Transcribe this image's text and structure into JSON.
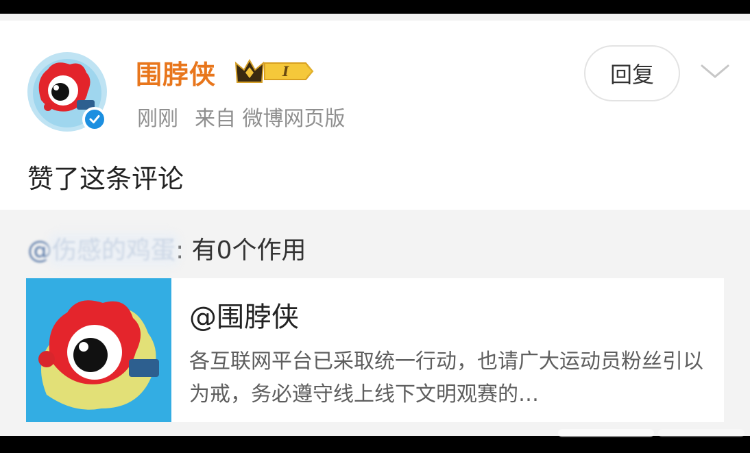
{
  "post": {
    "username": "围脖侠",
    "vip_level": "I",
    "time": "刚刚",
    "source": "来自 微博网页版",
    "reply_label": "回复",
    "comment": "赞了这条评论"
  },
  "quoted_comment": {
    "mention": "@伤感的鸡蛋",
    "text": ": 有0个作用"
  },
  "shared_card": {
    "title": "@围脖侠",
    "description": "各互联网平台已采取统一行动，也请广大运动员粉丝引以为戒，务必遵守线上线下文明观赛的…"
  },
  "colors": {
    "username": "#e8761c",
    "verified_badge": "#1c8fe0",
    "mention": "#5b7aa8",
    "quote_background": "#f3f3f3"
  },
  "icons": {
    "avatar": "weibo-eye-mascot",
    "verified": "verified-check-icon",
    "vip": "crown-vip-icon",
    "more": "chevron-down-icon"
  }
}
